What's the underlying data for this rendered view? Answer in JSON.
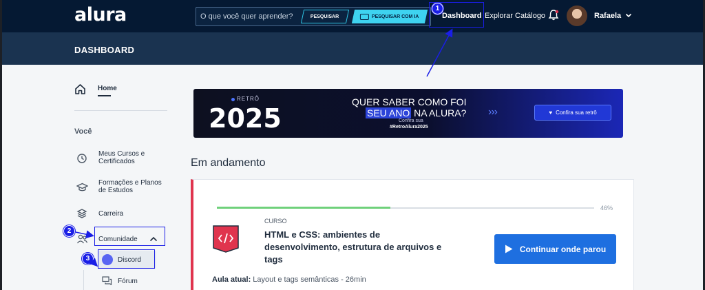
{
  "brand": {
    "logo": "alura"
  },
  "search": {
    "placeholder": "O que você quer aprender?",
    "search_label": "PESQUISAR",
    "ia_label": "PESQUISAR COM IA"
  },
  "nav": {
    "dashboard": "Dashboard",
    "catalog": "Explorar Catálogo",
    "user_name": "Rafaela"
  },
  "dashbar": {
    "title": "DASHBOARD"
  },
  "sidebar": {
    "home": "Home",
    "section_you": "Você",
    "items": [
      {
        "label": "Meus Cursos e Certificados",
        "icon": "history-icon"
      },
      {
        "label": "Formações e Planos de Estudos",
        "icon": "graduation-cap-icon"
      },
      {
        "label": "Carreira",
        "icon": "layers-icon"
      },
      {
        "label": "Comunidade",
        "icon": "people-icon"
      }
    ],
    "sub_items": [
      {
        "label": "Discord",
        "icon": "discord-icon"
      },
      {
        "label": "Fórum",
        "icon": "chat-icon"
      }
    ]
  },
  "banner": {
    "tag": "RETRÔ",
    "year": "2025",
    "line1": "QUER SABER COMO FOI",
    "line2_highlight": "SEU ANO",
    "line2_rest": "NA ALURA?",
    "sub1": "Confira sua",
    "sub2": "#RetroAlura2025",
    "arrows": "›››",
    "cta": "Confira sua retrô"
  },
  "in_progress": {
    "title": "Em andamento",
    "progress_percent": 46,
    "progress_label": "46%",
    "kind": "CURSO",
    "course_title": "HTML e CSS: ambientes de desenvolvimento, estrutura de arquivos e tags",
    "continue_label": "Continuar onde parou",
    "current_lesson_label": "Aula atual:",
    "current_lesson_value": "Layout e tags semânticas - 26min"
  },
  "annotations": {
    "badge1": "1",
    "badge2": "2",
    "badge3": "3"
  },
  "colors": {
    "highlight": "#1a1ee6",
    "accent_blue": "#1e6fe0",
    "course_red": "#e0344e",
    "progress_green": "#6fd17b",
    "nav_bg": "#051933"
  }
}
